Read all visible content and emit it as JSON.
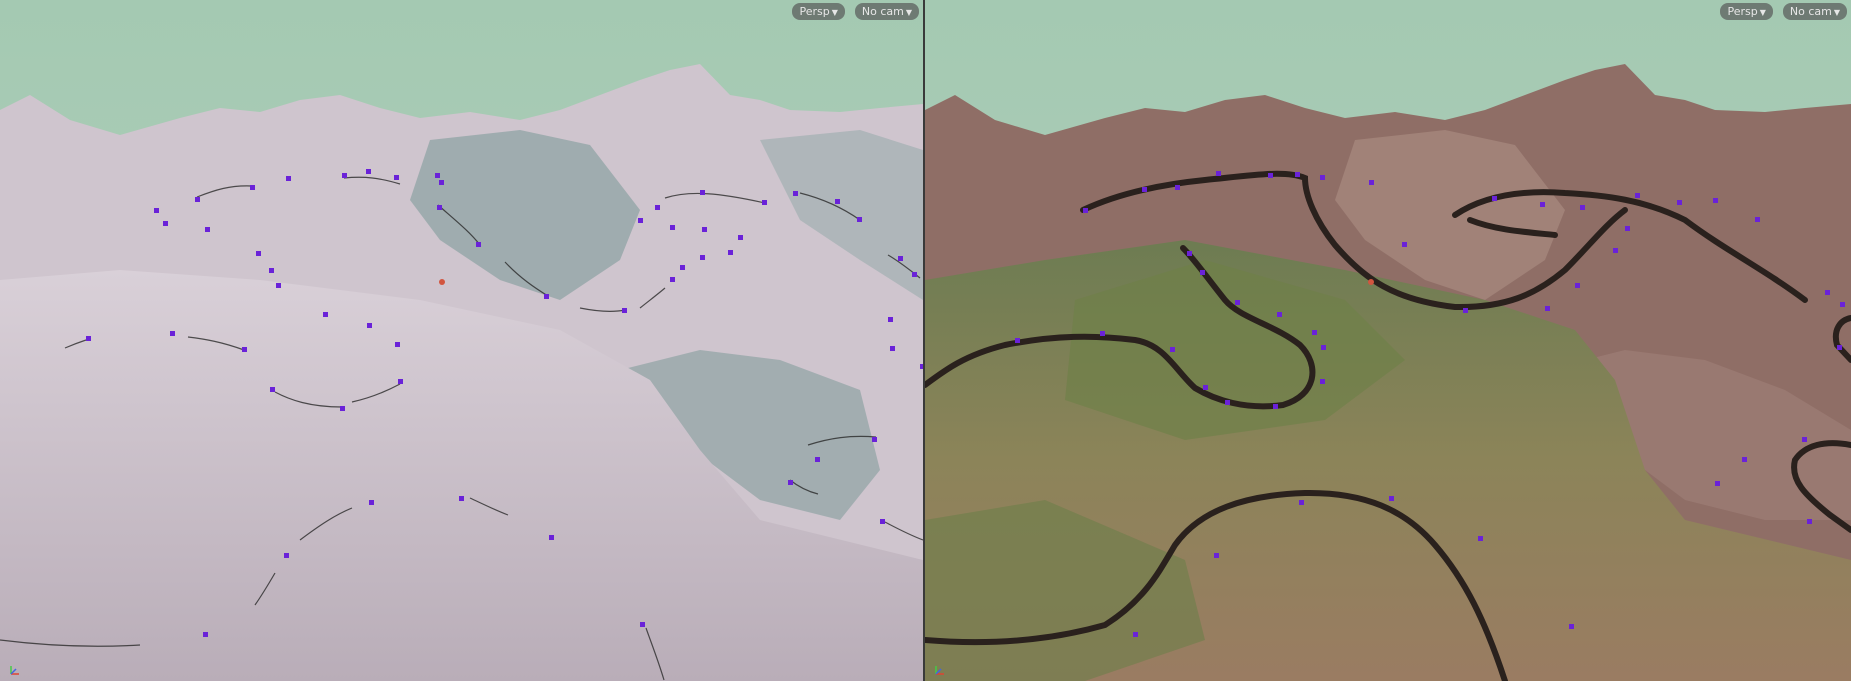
{
  "viewports": [
    {
      "id": "left",
      "shading": "untextured-clay",
      "view_menu": {
        "label": "Persp",
        "icon": "caret-down-icon"
      },
      "camera_menu": {
        "label": "No cam",
        "icon": "caret-down-icon"
      }
    },
    {
      "id": "right",
      "shading": "textured-terrain-with-road",
      "view_menu": {
        "label": "Persp",
        "icon": "caret-down-icon"
      },
      "camera_menu": {
        "label": "No cam",
        "icon": "caret-down-icon"
      }
    }
  ],
  "colors": {
    "sky": "#a9cbb4",
    "clay_terrain": "#cbbfc8",
    "clay_shadow": "#8fa3a4",
    "textured_ground": "#7f8a5c",
    "textured_rock": "#8f6e66",
    "road": "#2a211d",
    "curve_point": "#6a22d8",
    "divider": "#3a3a3a"
  }
}
